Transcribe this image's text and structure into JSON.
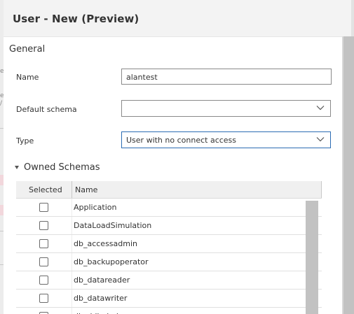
{
  "dialog": {
    "title": "User - New (Preview)"
  },
  "general": {
    "section_title": "General",
    "name_label": "Name",
    "name_value": "alantest",
    "default_schema_label": "Default schema",
    "default_schema_value": "",
    "type_label": "Type",
    "type_value": "User with no connect access"
  },
  "owned_schemas": {
    "title": "Owned Schemas",
    "columns": [
      "Selected",
      "Name"
    ],
    "rows": [
      {
        "name": "Application",
        "selected": false
      },
      {
        "name": "DataLoadSimulation",
        "selected": false
      },
      {
        "name": "db_accessadmin",
        "selected": false
      },
      {
        "name": "db_backupoperator",
        "selected": false
      },
      {
        "name": "db_datareader",
        "selected": false
      },
      {
        "name": "db_datawriter",
        "selected": false
      },
      {
        "name": "db_ddladmin",
        "selected": false
      }
    ]
  },
  "left_strip": {
    "glyphs": [
      "e",
      "e",
      "/"
    ]
  },
  "colors": {
    "focus_border": "#2b6cb3",
    "header_bg": "#f3f3f3",
    "scrollbar": "#c2c2c2"
  }
}
